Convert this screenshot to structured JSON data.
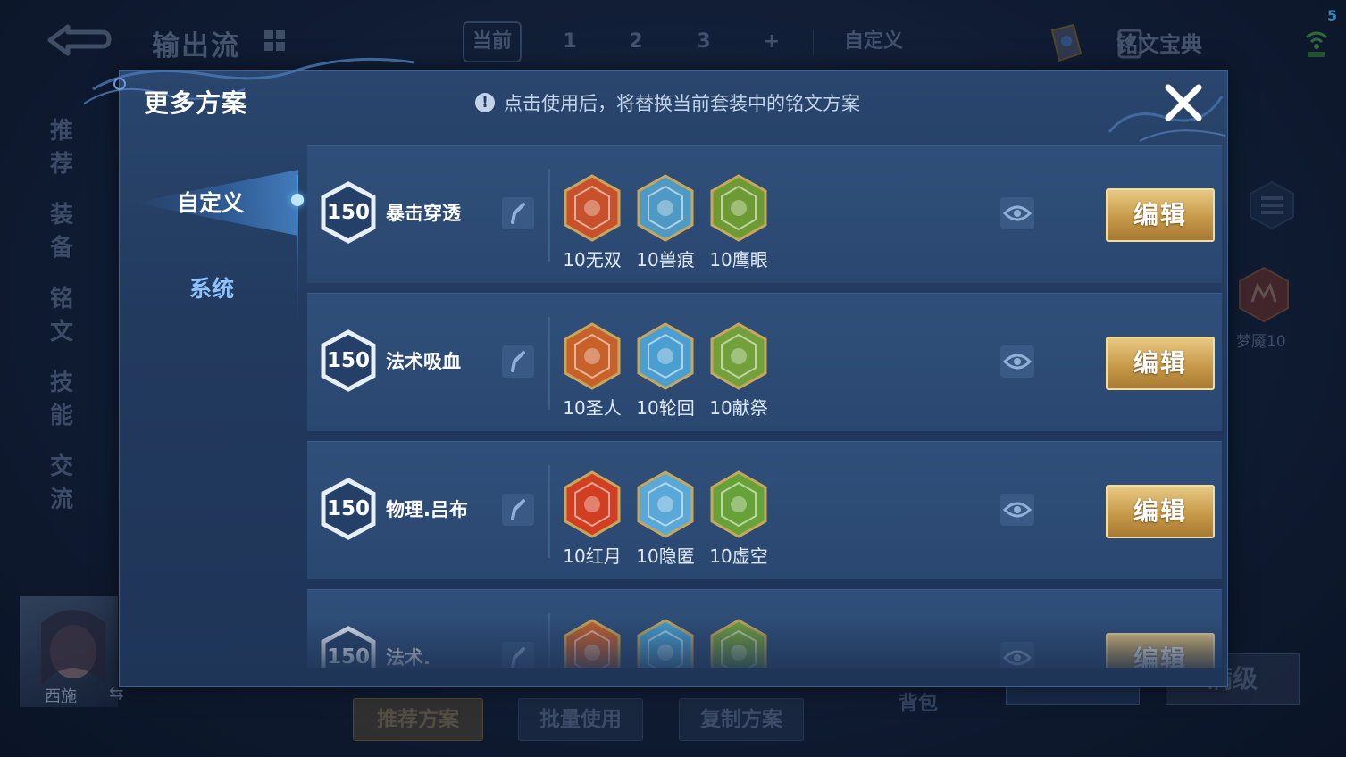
{
  "status": {
    "corner_number": "5"
  },
  "background": {
    "title": "输出流",
    "tabs": [
      "当前",
      "1",
      "2",
      "3",
      "+",
      "自定义"
    ],
    "dictionary": "铭文宝典",
    "side_nav": [
      "推荐",
      "装备",
      "铭文",
      "技能",
      "交流"
    ],
    "right_rune_label": "梦魇10",
    "hero_name": "西施",
    "bottom_buttons": [
      "推荐方案",
      "批量使用",
      "复制方案"
    ],
    "bag_label": "背包",
    "full_level_label": "满级"
  },
  "modal": {
    "title": "更多方案",
    "hint": "点击使用后，将替换当前套装中的铭文方案",
    "categories": [
      {
        "label": "自定义",
        "active": true
      },
      {
        "label": "系统",
        "active": false
      }
    ],
    "plans": [
      {
        "level": "150",
        "name": "暴击穿透",
        "runes": [
          {
            "label": "10无双",
            "icon": "red-rune-icon",
            "color": "#c8502a"
          },
          {
            "label": "10兽痕",
            "icon": "blue-rune-icon",
            "color": "#4f9ac4"
          },
          {
            "label": "10鹰眼",
            "icon": "green-rune-icon",
            "color": "#6d9a33"
          }
        ],
        "edit_label": "编辑"
      },
      {
        "level": "150",
        "name": "法术吸血",
        "runes": [
          {
            "label": "10圣人",
            "icon": "red-rune-icon",
            "color": "#c8602a"
          },
          {
            "label": "10轮回",
            "icon": "blue-rune-icon",
            "color": "#4a9fd0"
          },
          {
            "label": "10献祭",
            "icon": "green-rune-icon",
            "color": "#72a03a"
          }
        ],
        "edit_label": "编辑"
      },
      {
        "level": "150",
        "name": "物理.吕布",
        "runes": [
          {
            "label": "10红月",
            "icon": "red-rune-icon",
            "color": "#d23e22"
          },
          {
            "label": "10隐匿",
            "icon": "blue-rune-icon",
            "color": "#5aa8d8"
          },
          {
            "label": "10虚空",
            "icon": "green-rune-icon",
            "color": "#66a238"
          }
        ],
        "edit_label": "编辑"
      },
      {
        "level": "150",
        "name": "法术.",
        "runes": [
          {
            "label": "",
            "icon": "red-rune-icon",
            "color": "#c8602a"
          },
          {
            "label": "",
            "icon": "blue-rune-icon",
            "color": "#4a9fd0"
          },
          {
            "label": "",
            "icon": "green-rune-icon",
            "color": "#72a03a"
          }
        ],
        "edit_label": "编辑"
      }
    ]
  }
}
